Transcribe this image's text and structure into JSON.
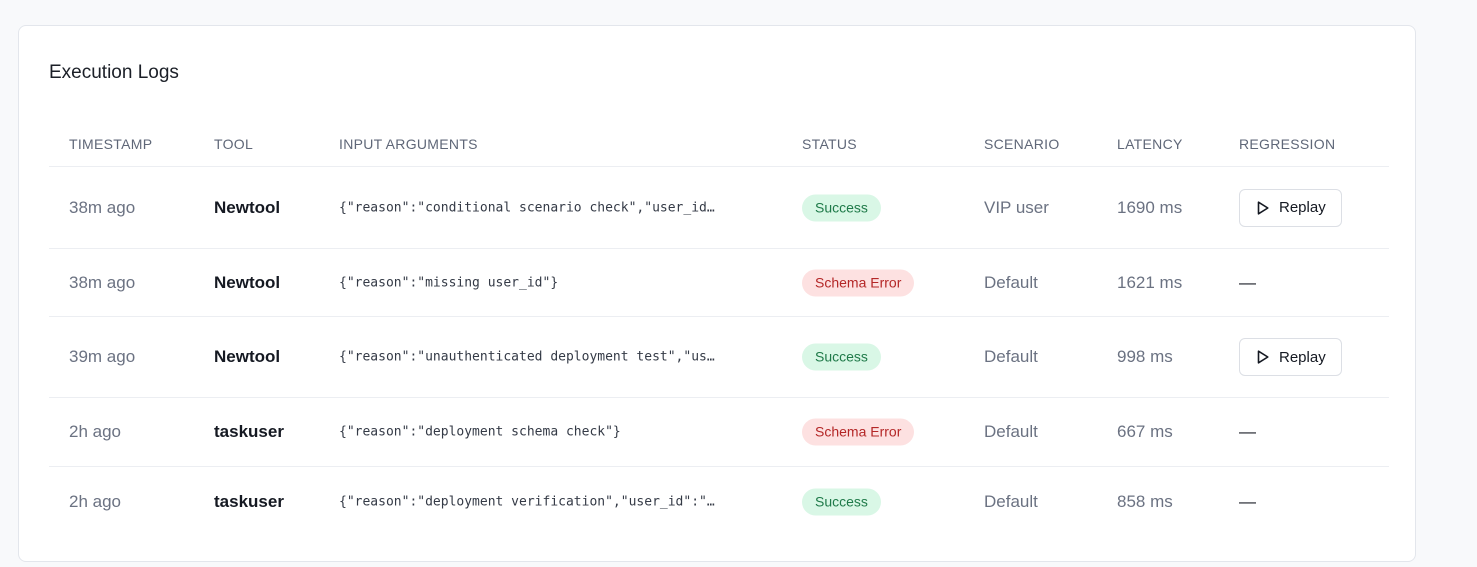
{
  "card": {
    "title": "Execution Logs"
  },
  "columns": {
    "timestamp": "Timestamp",
    "tool": "Tool",
    "input_arguments": "Input Arguments",
    "status": "Status",
    "scenario": "Scenario",
    "latency": "Latency",
    "regression": "Regression"
  },
  "rows": [
    {
      "timestamp": "38m ago",
      "tool": "Newtool",
      "args": "{\"reason\":\"conditional scenario check\",\"user_id…",
      "status": "Success",
      "status_kind": "success",
      "scenario": "VIP user",
      "latency": "1690 ms",
      "regression": "Replay",
      "regression_kind": "button"
    },
    {
      "timestamp": "38m ago",
      "tool": "Newtool",
      "args": "{\"reason\":\"missing user_id\"}",
      "status": "Schema Error",
      "status_kind": "error",
      "scenario": "Default",
      "latency": "1621 ms",
      "regression": "—",
      "regression_kind": "none"
    },
    {
      "timestamp": "39m ago",
      "tool": "Newtool",
      "args": "{\"reason\":\"unauthenticated deployment test\",\"us…",
      "status": "Success",
      "status_kind": "success",
      "scenario": "Default",
      "latency": "998 ms",
      "regression": "Replay",
      "regression_kind": "button"
    },
    {
      "timestamp": "2h ago",
      "tool": "taskuser",
      "args": "{\"reason\":\"deployment schema check\"}",
      "status": "Schema Error",
      "status_kind": "error",
      "scenario": "Default",
      "latency": "667 ms",
      "regression": "—",
      "regression_kind": "none"
    },
    {
      "timestamp": "2h ago",
      "tool": "taskuser",
      "args": "{\"reason\":\"deployment verification\",\"user_id\":\"…",
      "status": "Success",
      "status_kind": "success",
      "scenario": "Default",
      "latency": "858 ms",
      "regression": "—",
      "regression_kind": "none"
    }
  ],
  "icons": {
    "replay": "play-icon"
  },
  "colors": {
    "success_bg": "#d9f7e6",
    "success_text": "#1f7a49",
    "error_bg": "#fde1e1",
    "error_text": "#b42727"
  }
}
